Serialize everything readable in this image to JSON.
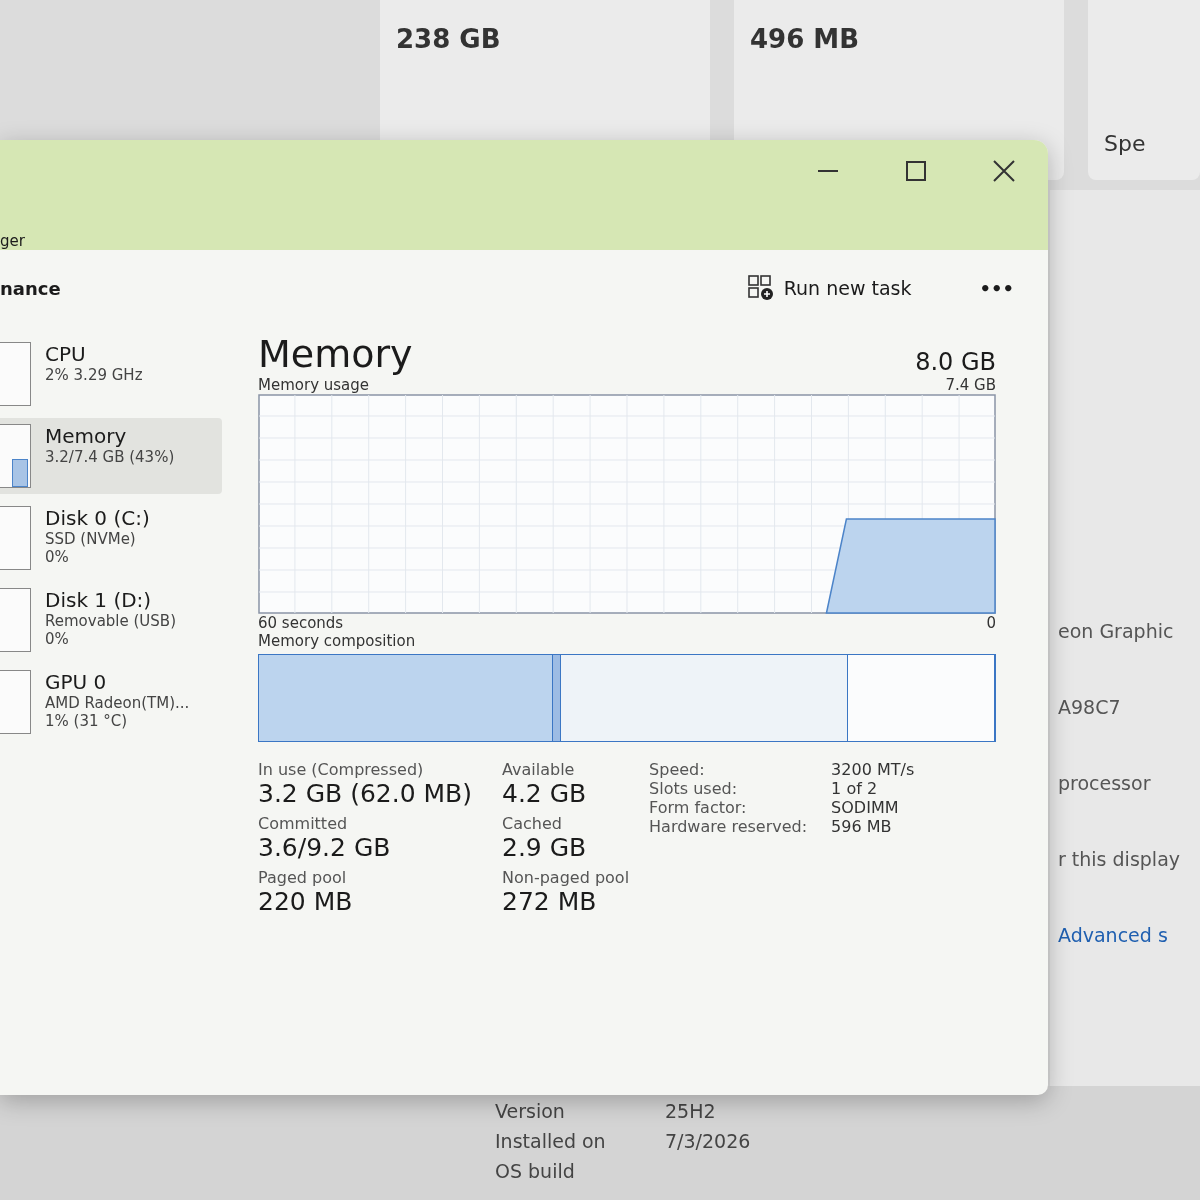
{
  "background": {
    "top_values": [
      "238 GB",
      "496 MB"
    ],
    "top_right_label": "Spe",
    "right_lines": [
      "eon Graphic",
      "A98C7",
      "processor",
      "r this display"
    ],
    "right_link": "Advanced s",
    "bottom_rows": [
      {
        "label": "Version",
        "value": "25H2"
      },
      {
        "label": "Installed on",
        "value": "7/3/2026"
      },
      {
        "label": "OS build"
      }
    ]
  },
  "window": {
    "title": "ger",
    "section": "nance",
    "run_new_task": "Run new task",
    "more": "•••"
  },
  "sidebar": {
    "items": [
      {
        "name": "CPU",
        "lines": [
          "2% 3.29 GHz"
        ],
        "selected": false
      },
      {
        "name": "Memory",
        "lines": [
          "3.2/7.4 GB (43%)"
        ],
        "selected": true
      },
      {
        "name": "Disk 0 (C:)",
        "lines": [
          "SSD (NVMe)",
          "0%"
        ],
        "selected": false
      },
      {
        "name": "Disk 1 (D:)",
        "lines": [
          "Removable (USB)",
          "0%"
        ],
        "selected": false
      },
      {
        "name": "GPU 0",
        "lines": [
          "AMD Radeon(TM)...",
          "1% (31 °C)"
        ],
        "selected": false
      }
    ]
  },
  "memory": {
    "title": "Memory",
    "total": "8.0 GB",
    "usage_label": "Memory usage",
    "usage_max": "7.4 GB",
    "time_span": "60 seconds",
    "usage_min": "0",
    "composition_label": "Memory composition",
    "stats": [
      {
        "label": "In use (Compressed)",
        "value": "3.2 GB (62.0 MB)"
      },
      {
        "label": "Available",
        "value": "4.2 GB"
      },
      {
        "label": "Committed",
        "value": "3.6/9.2 GB"
      },
      {
        "label": "Cached",
        "value": "2.9 GB"
      },
      {
        "label": "Paged pool",
        "value": "220 MB"
      },
      {
        "label": "Non-paged pool",
        "value": "272 MB"
      }
    ],
    "details": [
      {
        "label": "Speed:",
        "value": "3200 MT/s"
      },
      {
        "label": "Slots used:",
        "value": "1 of 2"
      },
      {
        "label": "Form factor:",
        "value": "SODIMM"
      },
      {
        "label": "Hardware reserved:",
        "value": "596 MB"
      }
    ]
  }
}
